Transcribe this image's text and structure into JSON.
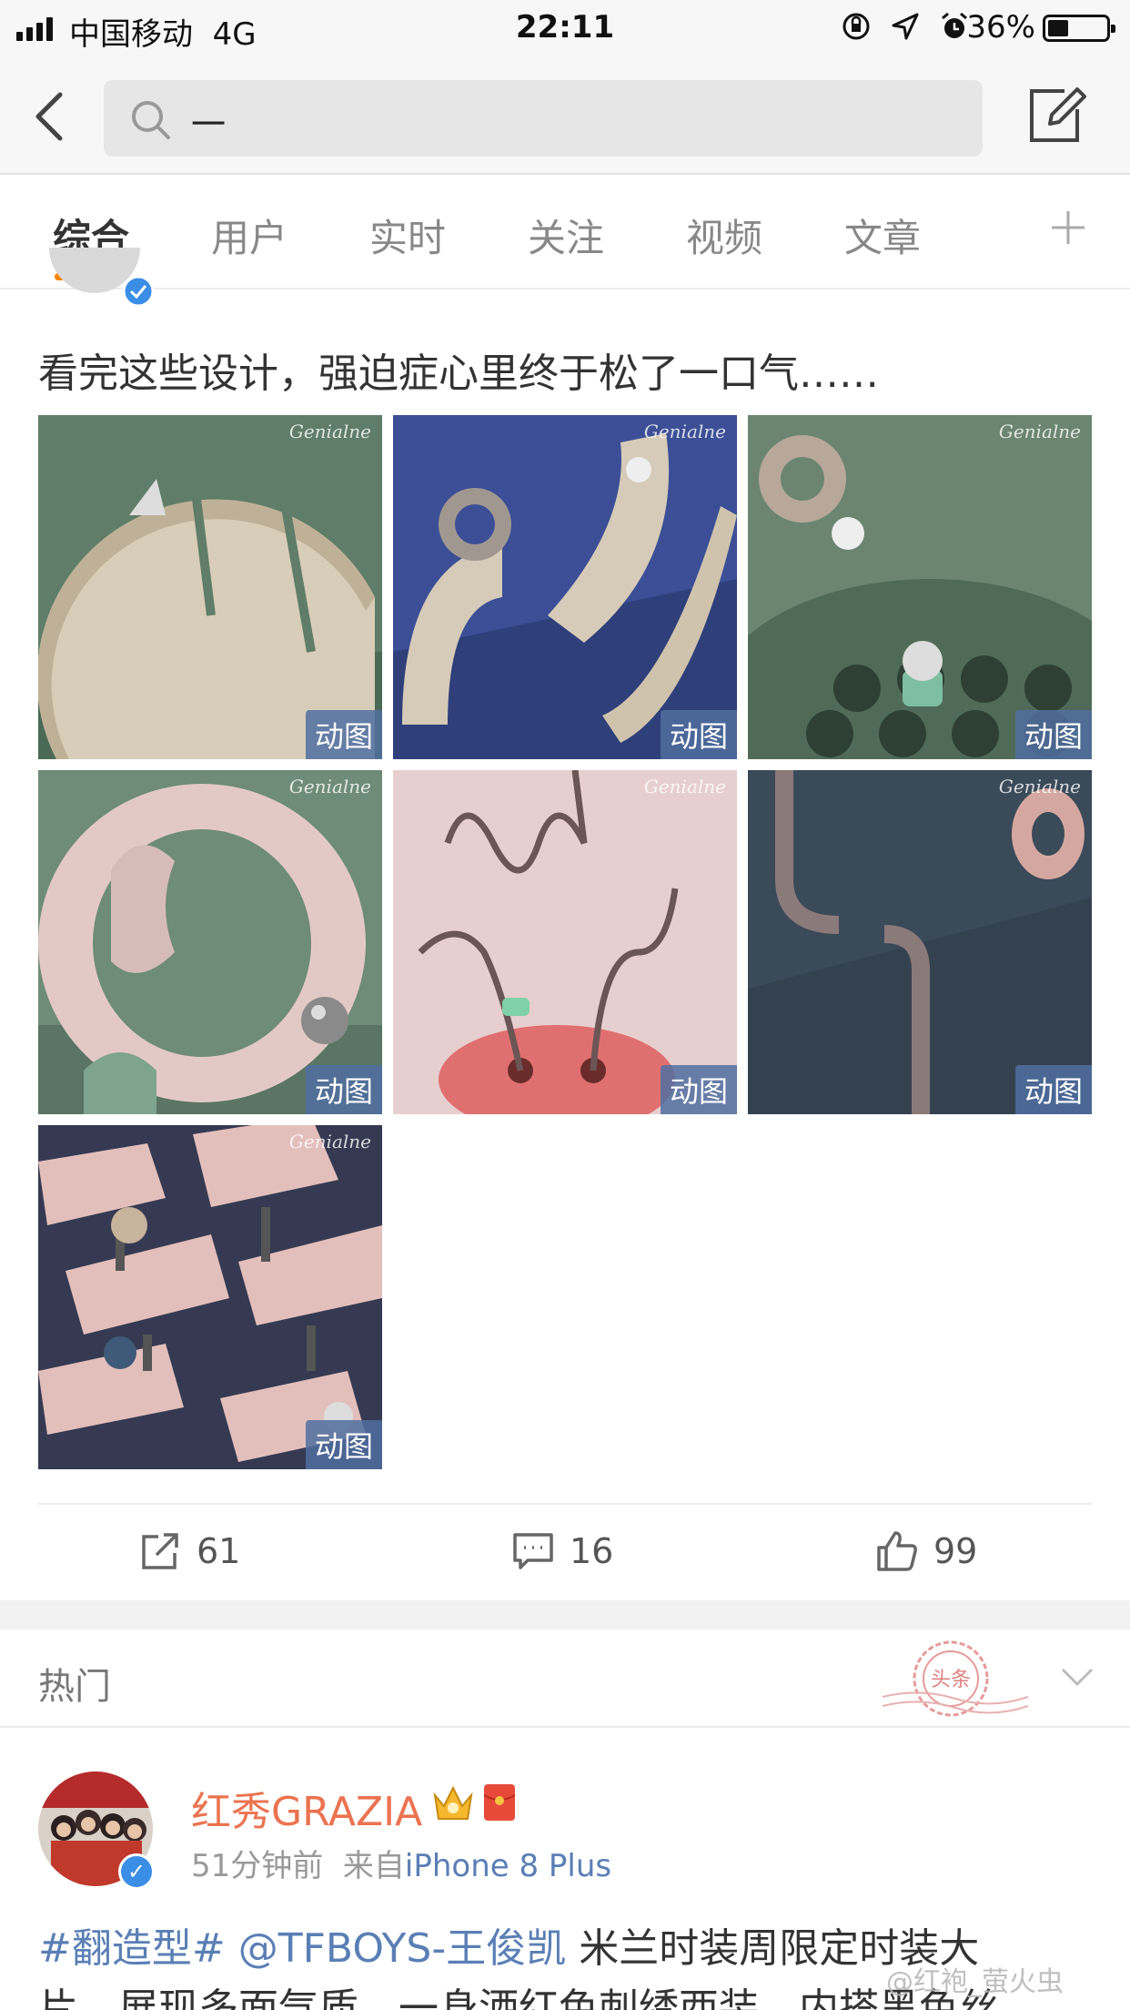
{
  "status_bar": {
    "carrier": "中国移动",
    "network": "4G",
    "time": "22:11",
    "battery_pct": "36%",
    "battery_level": 0.36,
    "icons": [
      "rotation-lock-icon",
      "location-icon",
      "alarm-icon"
    ]
  },
  "nav": {
    "search_text": "一",
    "icons": [
      "back-icon",
      "search-icon",
      "compose-icon"
    ]
  },
  "tabs": [
    {
      "label": "综合",
      "active": true
    },
    {
      "label": "用户",
      "active": false
    },
    {
      "label": "实时",
      "active": false
    },
    {
      "label": "关注",
      "active": false
    },
    {
      "label": "视频",
      "active": false
    },
    {
      "label": "文章",
      "active": false
    }
  ],
  "post1": {
    "text": "看完这些设计，强迫症心里终于松了一口气……",
    "gif_badge": "动图",
    "image_watermark": "Genialne",
    "images": [
      {
        "name": "gif-half-disc-cone",
        "bg": "#5f7d68"
      },
      {
        "name": "gif-curved-channel-ring",
        "bg": "#3c4f96"
      },
      {
        "name": "gif-holed-plate-ball",
        "bg": "#6b8571"
      },
      {
        "name": "gif-pink-ring-ball",
        "bg": "#6e8c77"
      },
      {
        "name": "gif-wire-maze",
        "bg": "#e8cfcf"
      },
      {
        "name": "gif-pipe-gap",
        "bg": "#3b4a59"
      },
      {
        "name": "gif-pink-troughs",
        "bg": "#353a52"
      }
    ],
    "shares": "61",
    "comments": "16",
    "likes": "99"
  },
  "hot_section": {
    "label": "热门",
    "stamp_text": "头条"
  },
  "post2": {
    "author": "红秀GRAZIA",
    "time": "51分钟前",
    "source_prefix": "来自",
    "source": "iPhone 8 Plus",
    "topic": "#翻造型#",
    "mention": "@TFBOYS-王俊凯",
    "text_line1": " 米兰时装周限定时装大",
    "text_line2": "片，展现多面气质，一身洒红色刺绣西装，内搭黑色丝",
    "corner_watermark": "@红袍_萤火虫"
  },
  "colors": {
    "accent": "#ff8200",
    "link": "#5a7fb5",
    "author": "#eb7350"
  }
}
